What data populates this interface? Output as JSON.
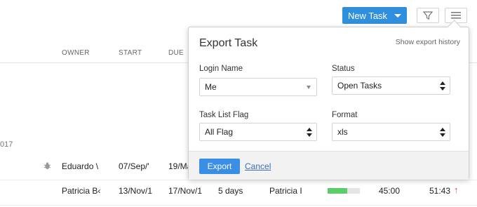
{
  "toolbar": {
    "new_task_label": "New Task",
    "icons": [
      "filter-icon",
      "menu-icon"
    ]
  },
  "table": {
    "headers": {
      "owner": "OWNER",
      "start": "START",
      "due": "DUE"
    },
    "group_year": "017",
    "rows": [
      {
        "owner": "Eduardo \\",
        "start": "07/Sep/'",
        "due": "19/Ma"
      },
      {
        "owner": "Patricia B‹",
        "start": "13/Nov/1",
        "due": "17/Nov/1",
        "duration": "5 days",
        "assignee": "Patricia I",
        "progress": 0.6,
        "time1": "45:00",
        "time2": "51:43"
      }
    ]
  },
  "popup": {
    "title": "Export Task",
    "history_link": "Show export history",
    "login_name": {
      "label": "Login Name",
      "value": "Me"
    },
    "status": {
      "label": "Status",
      "value": "Open Tasks"
    },
    "flag": {
      "label": "Task List Flag",
      "value": "All Flag"
    },
    "format": {
      "label": "Format",
      "value": "xls"
    },
    "export_label": "Export",
    "cancel_label": "Cancel"
  },
  "colors": {
    "accent": "#2f8fdc",
    "progress": "#5dcc6a",
    "up_arrow": "#e24b4b"
  }
}
